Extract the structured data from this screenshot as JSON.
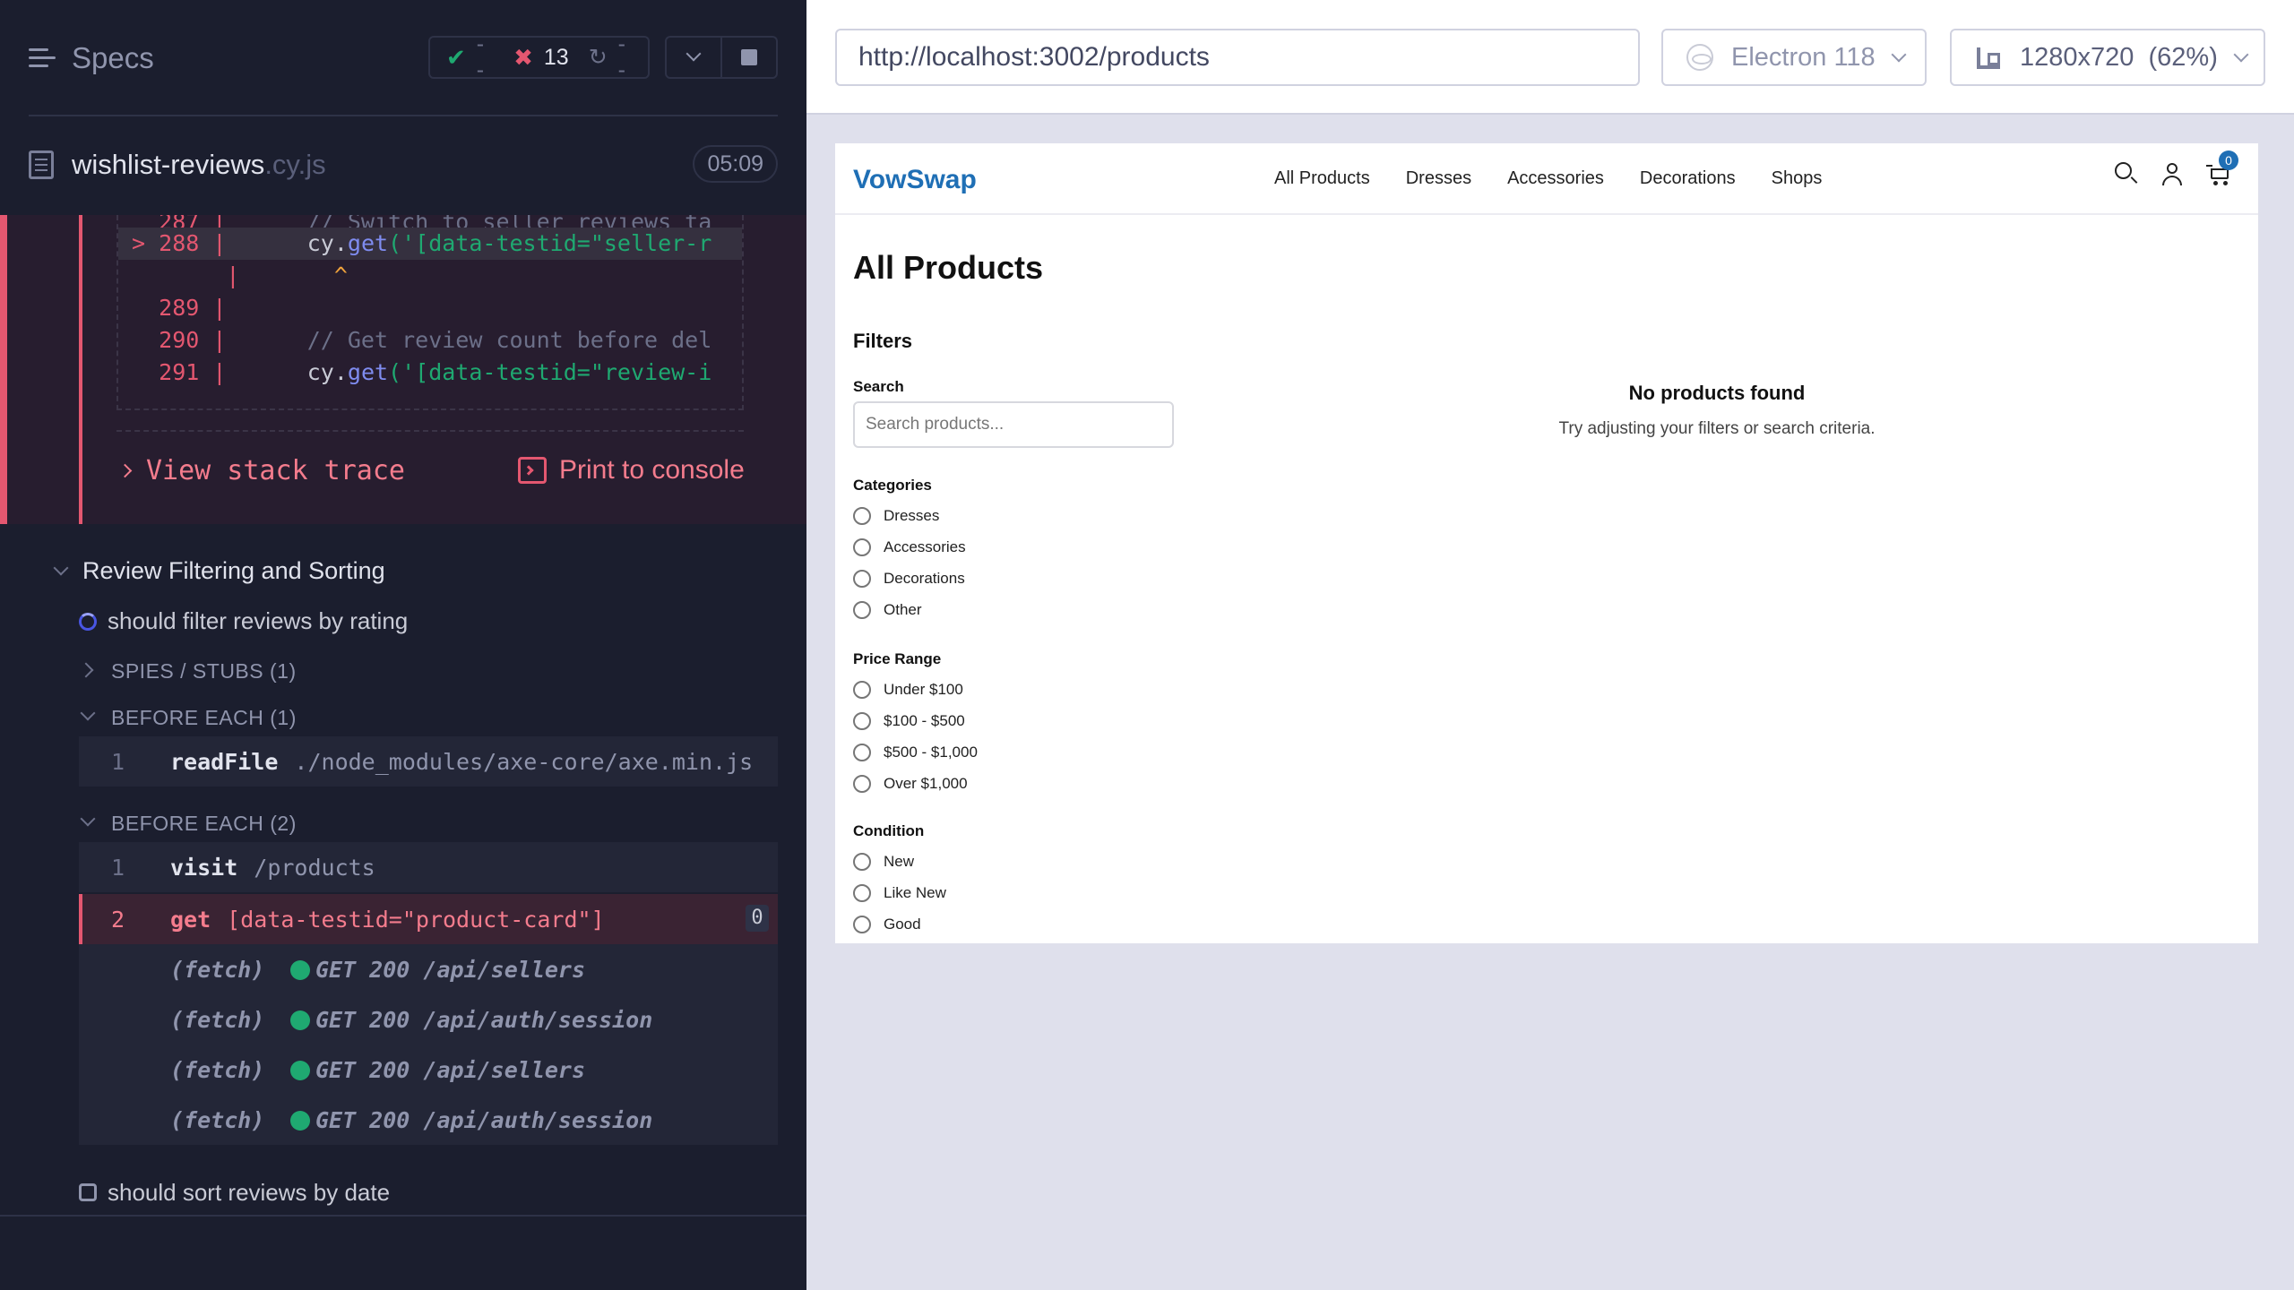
{
  "reporter": {
    "title": "Specs",
    "stats": {
      "passed": "--",
      "failed": "13",
      "pending": "--"
    },
    "spec": {
      "name": "wishlist-reviews",
      "ext": ".cy.js",
      "duration": "05:09"
    },
    "error": {
      "code_lines": [
        {
          "num": "287",
          "text": "// Switch to seller reviews ta",
          "kind": "comment"
        },
        {
          "num": "288",
          "marker": ">",
          "pre": "cy.",
          "fn": "get",
          "str": "('[data-testid=\"seller-r",
          "highlight": true
        },
        {
          "caret": "^"
        },
        {
          "num": "289",
          "text": ""
        },
        {
          "num": "290",
          "text": "// Get review count before del",
          "kind": "comment"
        },
        {
          "num": "291",
          "pre": "cy.",
          "fn": "get",
          "str": "('[data-testid=\"review-i"
        }
      ],
      "view_stack_trace": "View stack trace",
      "print_to_console": "Print to console"
    },
    "suite": {
      "title": "Review Filtering and Sorting",
      "running_test": "should filter reviews by rating",
      "spies": "SPIES / STUBS (1)",
      "before_each_1": "BEFORE EACH (1)",
      "before_each_2": "BEFORE EACH (2)",
      "pending_test": "should sort reviews by date"
    },
    "commands_1": [
      {
        "num": "1",
        "cmd": "readFile",
        "arg": "./node_modules/axe-core/axe.min.js"
      }
    ],
    "commands_2": [
      {
        "num": "1",
        "cmd": "visit",
        "arg": "/products"
      },
      {
        "num": "2",
        "cmd": "get",
        "arg": "[data-testid=\"product-card\"]",
        "badge": "0",
        "failed": true
      }
    ],
    "fetches": [
      {
        "label": "(fetch)",
        "request": "GET 200 /api/sellers"
      },
      {
        "label": "(fetch)",
        "request": "GET 200 /api/auth/session"
      },
      {
        "label": "(fetch)",
        "request": "GET 200 /api/sellers"
      },
      {
        "label": "(fetch)",
        "request": "GET 200 /api/auth/session"
      }
    ]
  },
  "aut": {
    "url": "http://localhost:3002/products",
    "browser": "Electron 118",
    "viewport": "1280x720  (62%)"
  },
  "app": {
    "logo": "VowSwap",
    "nav": [
      "All Products",
      "Dresses",
      "Accessories",
      "Decorations",
      "Shops"
    ],
    "cart_count": "0",
    "page_title": "All Products",
    "filters_title": "Filters",
    "search_label": "Search",
    "search_placeholder": "Search products...",
    "categories_label": "Categories",
    "categories": [
      "Dresses",
      "Accessories",
      "Decorations",
      "Other"
    ],
    "price_label": "Price Range",
    "prices": [
      "Under $100",
      "$100 - $500",
      "$500 - $1,000",
      "Over $1,000"
    ],
    "condition_label": "Condition",
    "conditions": [
      "New",
      "Like New",
      "Good"
    ],
    "empty_title": "No products found",
    "empty_subtitle": "Try adjusting your filters or search criteria."
  },
  "colors": {
    "accent": "#4956e3",
    "pass": "#1fa971",
    "fail": "#e45770",
    "brand": "#1f6fb5"
  }
}
